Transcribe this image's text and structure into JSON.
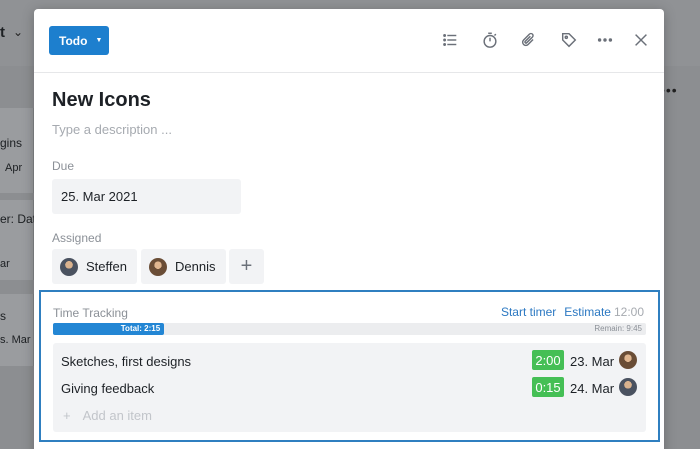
{
  "background": {
    "board_title": "t",
    "cards": [
      {
        "line1": "gins",
        "line2": "Apr"
      },
      {
        "line1": "er: Dat",
        "line2": "ar"
      },
      {
        "line1": "s",
        "line2": "s. Mar"
      }
    ]
  },
  "modal": {
    "status_label": "Todo",
    "title": "New Icons",
    "description_placeholder": "Type a description ...",
    "due": {
      "label": "Due",
      "value": "25. Mar 2021"
    },
    "assigned": {
      "label": "Assigned",
      "people": [
        "Steffen",
        "Dennis"
      ],
      "add_symbol": "+"
    },
    "header_icons": [
      "checklist-icon",
      "timer-icon",
      "attachment-icon",
      "tag-icon",
      "more-icon",
      "close-icon"
    ]
  },
  "time_tracking": {
    "label": "Time Tracking",
    "start_timer": "Start timer",
    "estimate_label": "Estimate",
    "estimate_value": "12:00",
    "total_label": "Total: 2:15",
    "remain_label": "Remain: 9:45",
    "progress_fraction": 0.1875,
    "items": [
      {
        "name": "Sketches, first designs",
        "time": "2:00",
        "date": "23. Mar"
      },
      {
        "name": "Giving feedback",
        "time": "0:15",
        "date": "24. Mar"
      }
    ],
    "add_item_symbol": "+",
    "add_item_placeholder": "Add an item"
  },
  "colors": {
    "accent": "#1d7fce",
    "time_badge": "#45bf55",
    "focus_border": "#2f7fc0"
  }
}
